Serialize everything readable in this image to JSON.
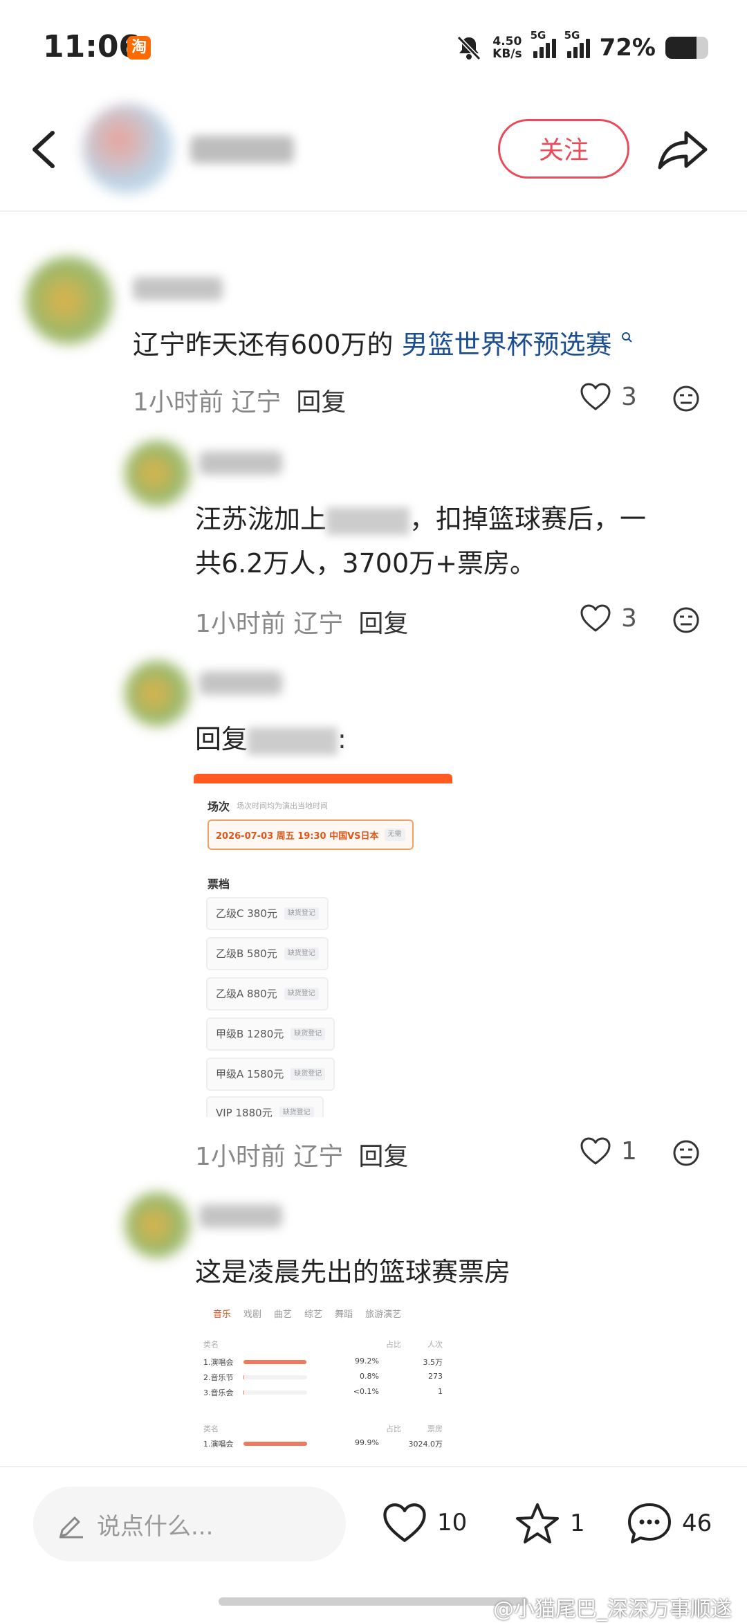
{
  "status_bar": {
    "time": "11:06",
    "app_badge": "淘",
    "net_speed_value": "4.50",
    "net_speed_unit": "KB/s",
    "sim1": "5G",
    "sim2": "5G",
    "battery": "72%",
    "battery_level": 0.72
  },
  "header": {
    "follow_label": "关注"
  },
  "comments": [
    {
      "text_prefix": "辽宁昨天还有600万的 ",
      "link_text": "男篮世界杯预选赛",
      "meta_time_loc": "1小时前 辽宁",
      "reply_label": "回复",
      "likes": "3"
    },
    {
      "text_part1": "汪苏泷加上",
      "text_part2": "，扣掉篮球赛后，一",
      "text_line2": "共6.2万人，3700万+票房。",
      "meta_time_loc": "1小时前 辽宁",
      "reply_label": "回复",
      "likes": "3"
    },
    {
      "reply_prefix": "回复",
      "reply_suffix": ":",
      "meta_time_loc": "1小时前 辽宁",
      "reply_label": "回复",
      "likes": "1"
    },
    {
      "text": "这是凌晨先出的篮球赛票房"
    }
  ],
  "ticket_shot": {
    "section_title": "场次",
    "section_note": "场次时间均为演出当地时间",
    "session": "2026-07-03 周五 19:30 中国VS日本",
    "session_tag": "无需",
    "tier_title": "票档",
    "tiers": [
      {
        "label": "乙级C 380元",
        "tag": "缺货登记"
      },
      {
        "label": "乙级B 580元",
        "tag": "缺货登记"
      },
      {
        "label": "乙级A 880元",
        "tag": "缺货登记"
      },
      {
        "label": "甲级B 1280元",
        "tag": "缺货登记"
      },
      {
        "label": "甲级A 1580元",
        "tag": "缺货登记"
      },
      {
        "label": "VIP 1880元",
        "tag": "缺货登记"
      }
    ]
  },
  "rank_shot": {
    "tabs": [
      "音乐",
      "戏剧",
      "曲艺",
      "综艺",
      "舞蹈",
      "旅游演艺"
    ],
    "header1": {
      "name": "类名",
      "ratio": "占比",
      "value": "人次"
    },
    "rows1": [
      {
        "name": "1.演唱会",
        "ratio": "99.2%",
        "value": "3.5万",
        "fill": 0.992
      },
      {
        "name": "2.音乐节",
        "ratio": "0.8%",
        "value": "273",
        "fill": 0.008
      },
      {
        "name": "3.音乐会",
        "ratio": "<0.1%",
        "value": "1",
        "fill": 0.001
      }
    ],
    "header2": {
      "name": "类名",
      "ratio": "占比",
      "value": "票房"
    },
    "rows2": [
      {
        "name": "1.演唱会",
        "ratio": "99.9%",
        "value": "3024.0万",
        "fill": 0.999
      }
    ]
  },
  "bottom_bar": {
    "input_placeholder": "说点什么...",
    "likes": "10",
    "favorites": "1",
    "comments": "46"
  },
  "watermark": "@小猫尾巴_深深万事顺遂"
}
